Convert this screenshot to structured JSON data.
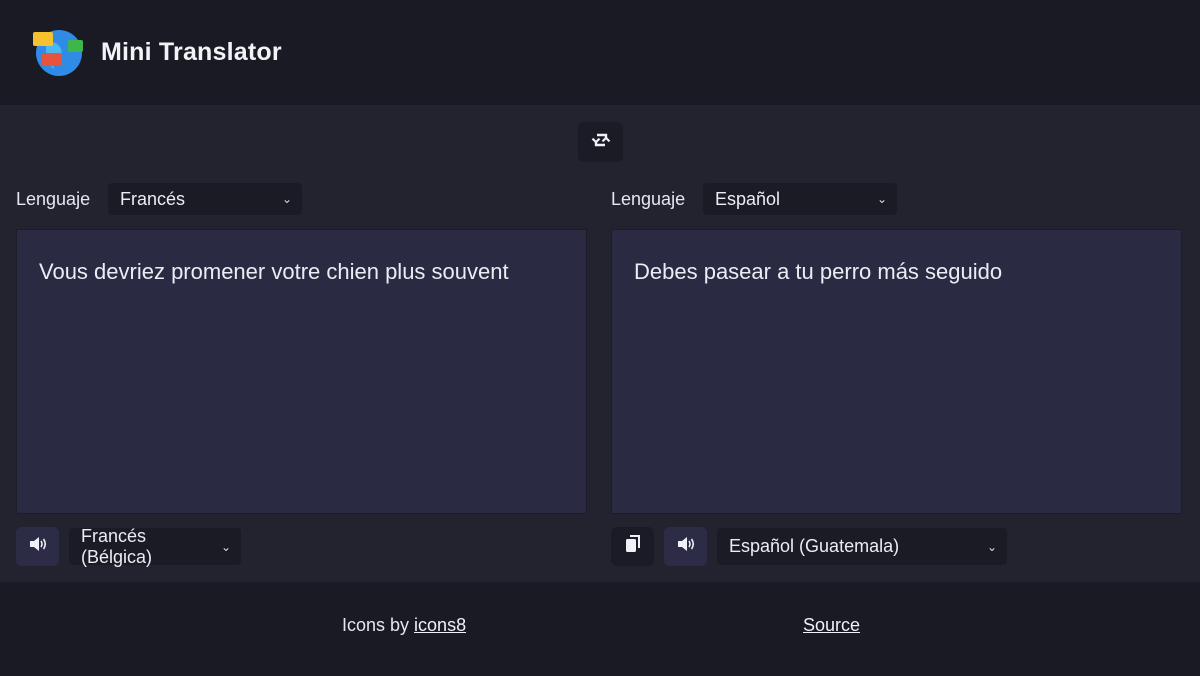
{
  "app": {
    "title": "Mini Translator"
  },
  "source": {
    "language_label": "Lenguaje",
    "language_value": "Francés",
    "text": "Vous devriez promener votre chien plus souvent",
    "voice_value": "Francés (Bélgica)"
  },
  "target": {
    "language_label": "Lenguaje",
    "language_value": "Español",
    "text": "Debes pasear a tu perro más seguido",
    "voice_value": "Español (Guatemala)"
  },
  "footer": {
    "credit_prefix": "Icons by ",
    "credit_link": "icons8",
    "source_link": "Source"
  },
  "icons": {
    "logo": "globe-chat-icon",
    "swap": "swap-arrows-icon",
    "speaker": "speaker-icon",
    "copy": "copy-icon",
    "chevron": "chevron-down-icon"
  },
  "colors": {
    "header_bg": "#1a1a24",
    "main_bg": "#232330",
    "textbox_bg": "#2a2a42",
    "control_bg": "#1b1b26"
  }
}
